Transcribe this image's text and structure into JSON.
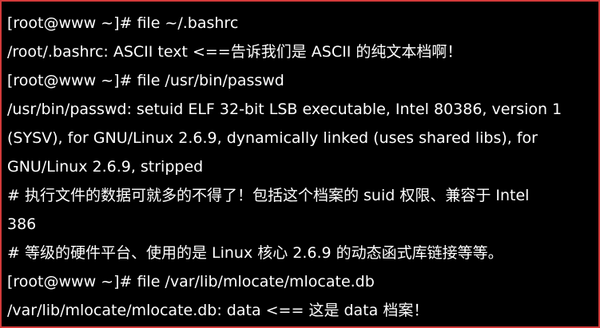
{
  "terminal": {
    "lines": [
      "[root@www ~]# file ~/.bashrc",
      "/root/.bashrc: ASCII text  <==告诉我们是 ASCII 的纯文本档啊！",
      "[root@www ~]# file /usr/bin/passwd",
      "/usr/bin/passwd: setuid ELF 32-bit LSB executable, Intel 80386, version 1",
      "(SYSV), for GNU/Linux 2.6.9, dynamically linked (uses shared libs), for",
      "GNU/Linux 2.6.9, stripped",
      "# 执行文件的数据可就多的不得了！包括这个档案的 suid 权限、兼容于 Intel",
      "386",
      "# 等级的硬件平台、使用的是 Linux 核心 2.6.9 的动态函式库链接等等。",
      "[root@www ~]# file /var/lib/mlocate/mlocate.db",
      "/var/lib/mlocate/mlocate.db: data  <== 这是 data 档案！"
    ]
  }
}
